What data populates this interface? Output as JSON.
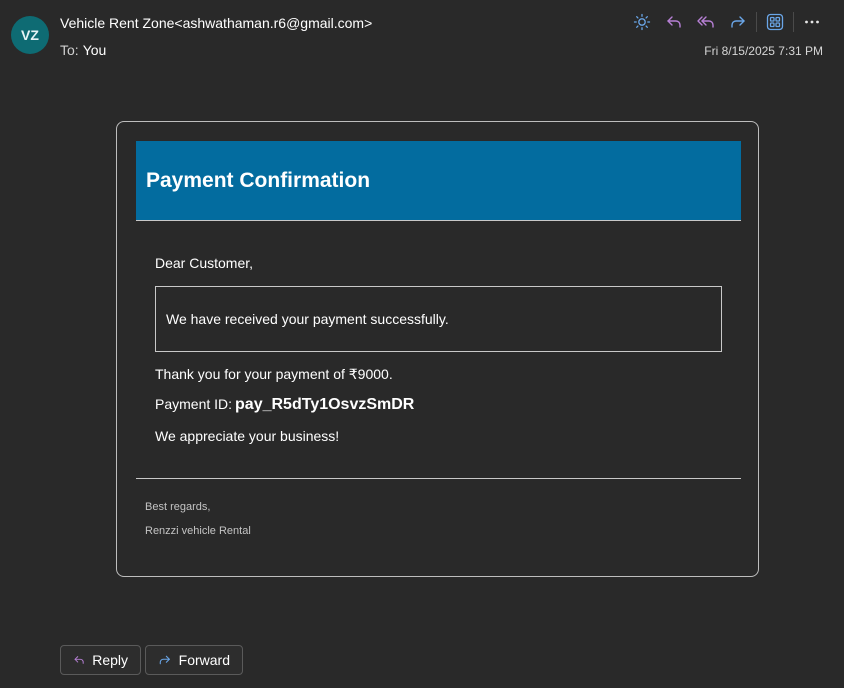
{
  "header": {
    "avatar_initials": "VZ",
    "sender": "Vehicle Rent Zone<ashwathaman.r6@gmail.com>",
    "to_label": "To:",
    "to_value": "You",
    "date": "Fri 8/15/2025 7:31 PM"
  },
  "toolbar": {
    "icons": [
      "brightness-icon",
      "reply-icon",
      "reply-all-icon",
      "forward-icon",
      "apps-icon",
      "more-icon"
    ]
  },
  "email": {
    "banner_title": "Payment Confirmation",
    "greeting": "Dear Customer,",
    "notice": "We have received your payment successfully.",
    "thanks": "Thank you for your payment of ₹9000.",
    "payment_id_label": "Payment ID:",
    "payment_id_value": "pay_R5dTy1OsvzSmDR",
    "appreciate": "We appreciate your business!",
    "regards": "Best regards,",
    "company": "Renzzi vehicle Rental"
  },
  "actions": {
    "reply_label": "Reply",
    "forward_label": "Forward"
  },
  "colors": {
    "background": "#292929",
    "banner": "#036c9f",
    "avatar": "#0e6b73",
    "icon_blue": "#6aa6e8",
    "icon_purple": "#b780d6"
  }
}
